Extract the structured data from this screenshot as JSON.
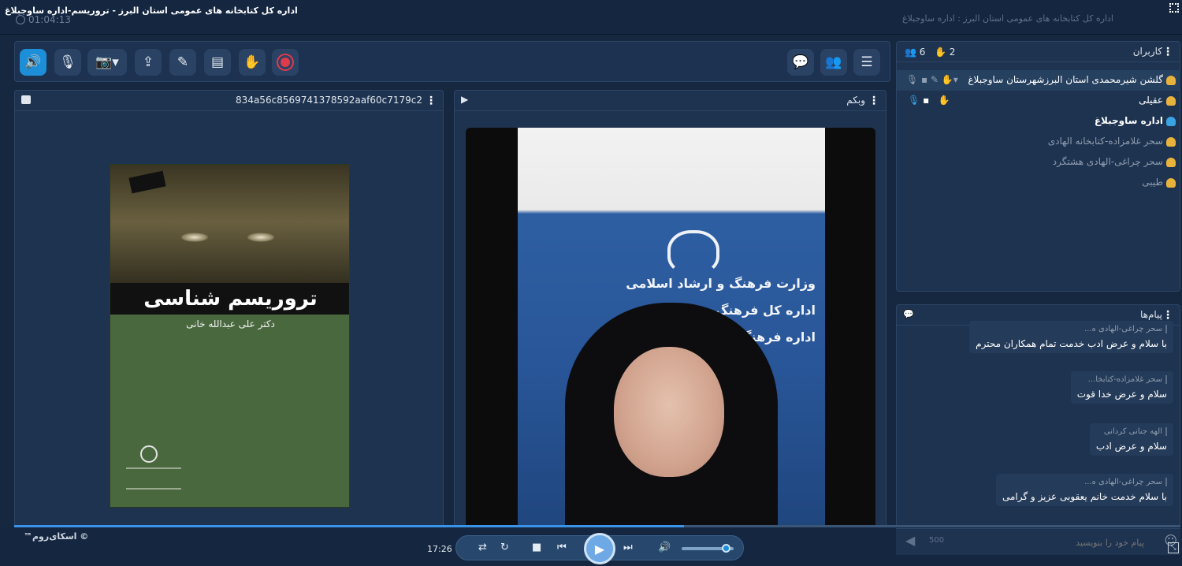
{
  "window": {
    "title": "اداره کل کتابخانه های عمومی استان البرز  -  تروریسم-اداره ساوجبلاغ",
    "subtitle": "اداره کل کتابخانه های عمومی استان البرز  :  اداره ساوجبلاغ",
    "elapsed": "01:04:13"
  },
  "toolbar": {
    "left_buttons": [
      "speaker-icon",
      "mic-off-icon",
      "camera-off-icon",
      "share-screen-icon",
      "brush-icon",
      "files-icon",
      "hand-icon",
      "record-icon"
    ],
    "right_buttons": [
      "chat-icon",
      "users-icon",
      "menu-icon"
    ]
  },
  "document": {
    "title": "834a56c8569741378592aaf60c7179c2",
    "book_title": "تروریسم شناسی",
    "book_author": "دکتر علی عبدالله خانی"
  },
  "webcam": {
    "title": "وبکم",
    "banner": [
      "وزارت فرهنگ و ارشاد اسلامی",
      "اداره کل فرهنگ و ا          البرز",
      "اداره فرهنگ و ارشا            لاغ"
    ]
  },
  "users": {
    "title": "کاربران",
    "count": "6",
    "hands": "2",
    "list": [
      {
        "name": "گلشن شیرمحمدی استان البرزشهرستان ساوجبلاغ",
        "color": "#e8b33c",
        "bold": false
      },
      {
        "name": "عقیلی",
        "color": "#e8b33c",
        "bold": false
      },
      {
        "name": "اداره ساوجبلاغ",
        "color": "#3aa3e3",
        "bold": true
      },
      {
        "name": "سحر غلامزاده-کتابخانه الهادی",
        "color": "#e8b33c",
        "bold": false
      },
      {
        "name": "سحر چراغی-الهادی هشتگرد",
        "color": "#e8b33c",
        "bold": false
      },
      {
        "name": "طیبی",
        "color": "#e8b33c",
        "bold": false
      }
    ]
  },
  "chat": {
    "title": "پیام‌ها",
    "messages": [
      {
        "sender": "سحر چراغی-الهادی ه...",
        "text": "با سلام و عرض ادب خدمت تمام همکاران محترم"
      },
      {
        "sender": "سحر غلامزاده-کتابخا...",
        "text": "سلام و عرض خدا قوت"
      },
      {
        "sender": "الهه جنانی کردانی",
        "text": "سلام و عرض ادب"
      },
      {
        "sender": "سحر چراغی-الهادی ه...",
        "text": "با سلام خدمت خانم یعقوبی عزیز و گرامی"
      }
    ],
    "input_placeholder": "پیام خود را بنویسید",
    "char_limit": "500"
  },
  "player": {
    "brand": "™اسکای‌روم ©",
    "time": "17:26",
    "progress": 0.574,
    "volume": 0.85
  }
}
